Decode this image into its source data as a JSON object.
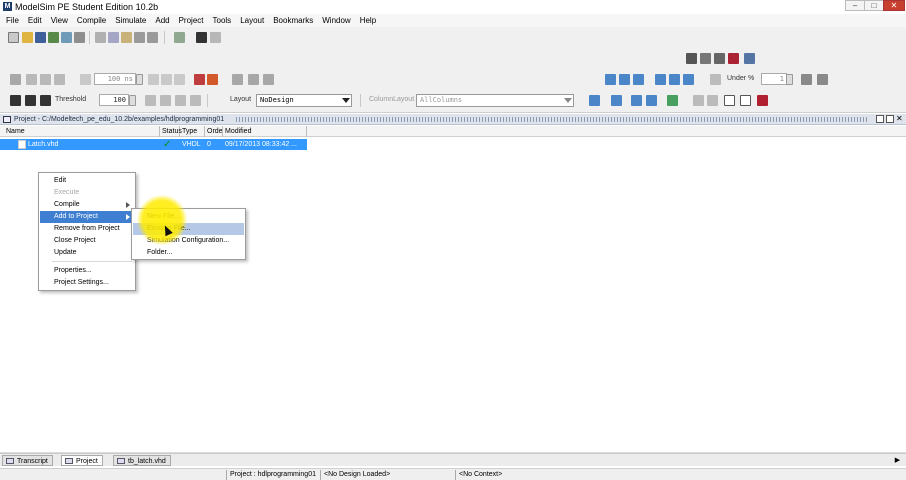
{
  "window": {
    "title": "ModelSim PE Student Edition 10.2b",
    "logo": "M"
  },
  "menus": [
    "File",
    "Edit",
    "View",
    "Compile",
    "Simulate",
    "Add",
    "Project",
    "Tools",
    "Layout",
    "Bookmarks",
    "Window",
    "Help"
  ],
  "toolbar": {
    "run_length": "100 ns",
    "threshold_label": "Threshold",
    "threshold_value": "100",
    "layout_label": "Layout",
    "layout_value": "NoDesign",
    "column_layout_label": "ColumnLayout",
    "column_layout_value": "AllColumns",
    "under_label": "Under %",
    "under_value": "1"
  },
  "project_panel": {
    "title": "Project - C:/Modeltech_pe_edu_10.2b/examples/hdlprogramming01",
    "columns": [
      "Name",
      "Status",
      "Type",
      "Order",
      "Modified"
    ],
    "rows": [
      {
        "name": "Latch.vhd",
        "type": "VHDL",
        "order": "0",
        "modified": "09/17/2013 08:33:42 ..."
      }
    ]
  },
  "context_menu": {
    "items": [
      {
        "label": "Edit"
      },
      {
        "label": "Execute"
      },
      {
        "label": "Compile"
      },
      {
        "label": "Add to Project"
      },
      {
        "label": "Remove from Project"
      },
      {
        "label": "Close Project"
      },
      {
        "label": "Update"
      },
      {
        "label": "Properties..."
      },
      {
        "label": "Project Settings..."
      }
    ]
  },
  "submenu": {
    "items": [
      {
        "label": "New File..."
      },
      {
        "label": "Existing File..."
      },
      {
        "label": "Simulation Configuration..."
      },
      {
        "label": "Folder..."
      }
    ]
  },
  "tabs": [
    "Transcript",
    "Project",
    "tb_latch.vhd"
  ],
  "status_bar": {
    "project": "Project : hdlprogramming01",
    "design": "<No Design Loaded>",
    "context": "<No Context>"
  },
  "colors": {
    "selection": "#3399ff",
    "menu_highlight": "#3f7fd1",
    "spotlight": "#ffeb00"
  }
}
